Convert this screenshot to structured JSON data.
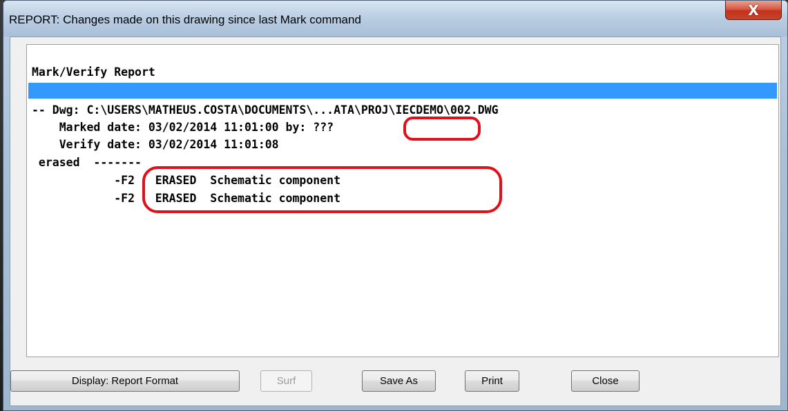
{
  "window": {
    "title": "REPORT: Changes made on this drawing since last Mark command",
    "close_glyph": "X"
  },
  "report": {
    "heading": "Mark/Verify Report",
    "dwg_line": "-- Dwg: C:\\USERS\\MATHEUS.COSTA\\DOCUMENTS\\...ATA\\PROJ\\IECDEMO\\002.DWG",
    "marked_line": "    Marked date: 03/02/2014 11:01:00 by: ???",
    "verify_line": "    Verify date: 03/02/2014 11:01:08",
    "erased_line": " erased  -------",
    "entries": [
      "            -F2   ERASED  Schematic component",
      "            -F2   ERASED  Schematic component"
    ]
  },
  "buttons": {
    "display_format": "Display: Report Format",
    "surf": "Surf",
    "save_as": "Save As",
    "print": "Print",
    "close": "Close"
  },
  "colors": {
    "selection_bar": "#3399ff",
    "annotation": "#e0101a",
    "close_button": "#c3321c"
  }
}
